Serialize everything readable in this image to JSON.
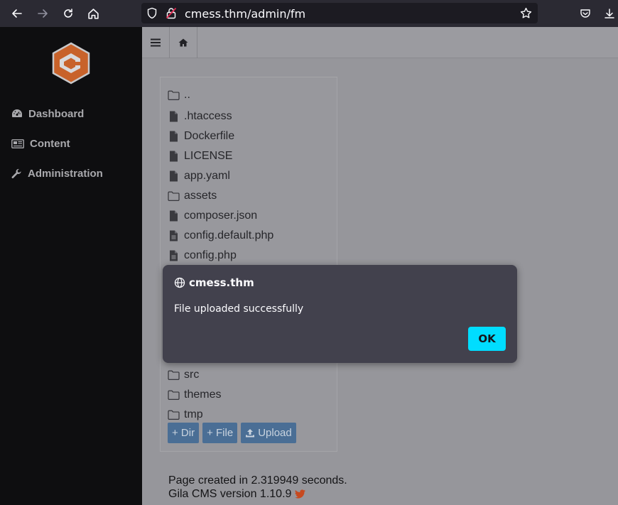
{
  "browser": {
    "url": "cmess.thm/admin/fm",
    "icons": [
      "back-icon",
      "forward-icon",
      "reload-icon",
      "home-icon",
      "shield-icon",
      "insecure-lock-icon",
      "bookmark-star-icon",
      "pocket-icon",
      "download-icon"
    ]
  },
  "sidebar": {
    "items": [
      {
        "label": "Dashboard",
        "icon": "dashboard-icon"
      },
      {
        "label": "Content",
        "icon": "newspaper-icon"
      },
      {
        "label": "Administration",
        "icon": "wrench-icon"
      }
    ],
    "logo_color": "#c8622a"
  },
  "files": [
    {
      "name": "..",
      "type": "folder"
    },
    {
      "name": ".htaccess",
      "type": "file"
    },
    {
      "name": "Dockerfile",
      "type": "file"
    },
    {
      "name": "LICENSE",
      "type": "file"
    },
    {
      "name": "app.yaml",
      "type": "file"
    },
    {
      "name": "assets",
      "type": "folder"
    },
    {
      "name": "composer.json",
      "type": "file"
    },
    {
      "name": "config.default.php",
      "type": "file-text"
    },
    {
      "name": "config.php",
      "type": "file-text"
    },
    {
      "name": "src",
      "type": "folder"
    },
    {
      "name": "themes",
      "type": "folder"
    },
    {
      "name": "tmp",
      "type": "folder"
    }
  ],
  "actions": {
    "dir": "+ Dir",
    "file": "+ File",
    "upload": "Upload"
  },
  "footer": {
    "line1": "Page created in 2.319949 seconds.",
    "line2": "Gila CMS version 1.10.9"
  },
  "dialog": {
    "title": "cmess.thm",
    "message": "File uploaded successfully",
    "ok": "OK",
    "ok_color": "#00ddff"
  }
}
